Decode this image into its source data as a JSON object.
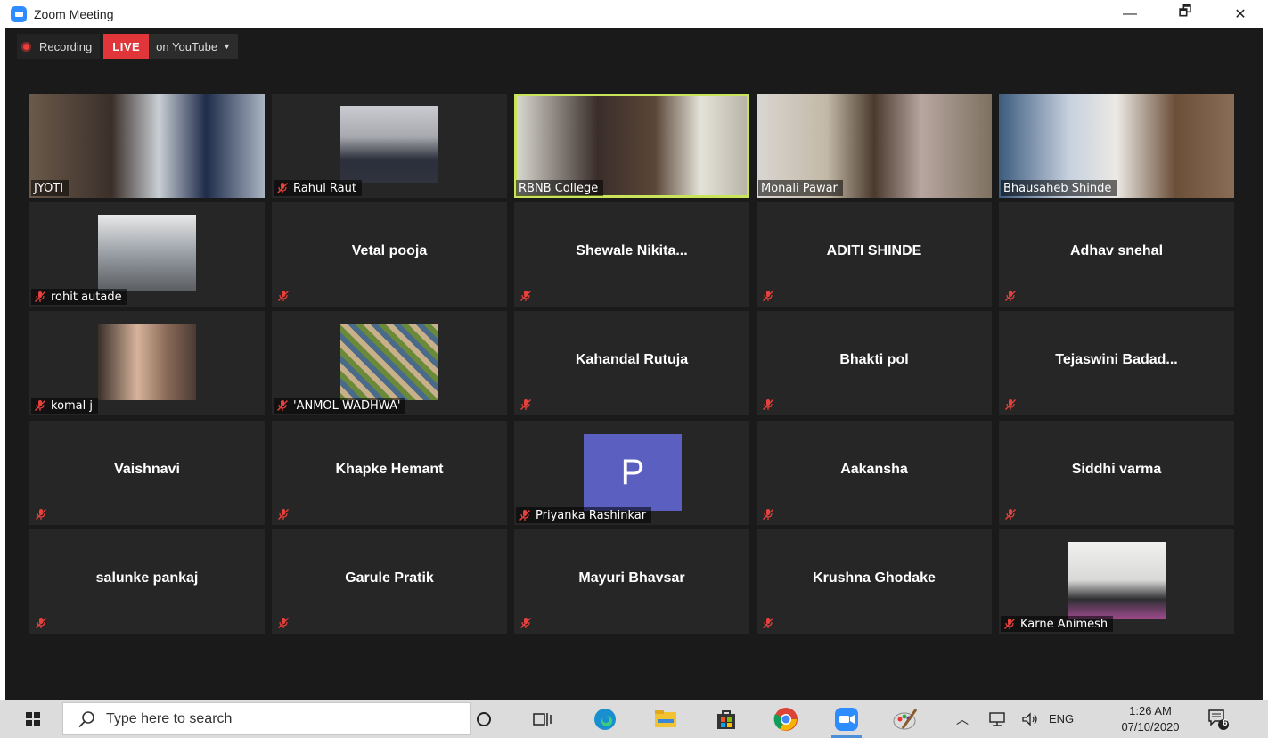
{
  "window": {
    "title": "Zoom Meeting",
    "minimize": "—",
    "restore": "🗗",
    "close": "✕"
  },
  "recording": {
    "label": "Recording",
    "live": "LIVE",
    "platform": "on YouTube",
    "caret": "▼"
  },
  "participants": [
    {
      "name": "JYOTI",
      "video": true,
      "muted": false
    },
    {
      "name": "Rahul Raut",
      "video": true,
      "muted": true
    },
    {
      "name": "RBNB College",
      "video": true,
      "muted": false,
      "active_speaker": true
    },
    {
      "name": "Monali Pawar",
      "video": true,
      "muted": false
    },
    {
      "name": "Bhausaheb Shinde",
      "video": true,
      "muted": false
    },
    {
      "name": "rohit autade",
      "video": true,
      "muted": true
    },
    {
      "name": "Vetal pooja",
      "video": false,
      "muted": true
    },
    {
      "name": "Shewale  Nikita...",
      "video": false,
      "muted": true
    },
    {
      "name": "ADITI SHINDE",
      "video": false,
      "muted": true
    },
    {
      "name": "Adhav snehal",
      "video": false,
      "muted": true
    },
    {
      "name": "komal j",
      "video": true,
      "muted": true
    },
    {
      "name": "'ANMOL WADHWA'",
      "video": true,
      "muted": true
    },
    {
      "name": "Kahandal  Rutuja",
      "video": false,
      "muted": true
    },
    {
      "name": "Bhakti pol",
      "video": false,
      "muted": true
    },
    {
      "name": "Tejaswini  Badad...",
      "video": false,
      "muted": true
    },
    {
      "name": "Vaishnavi",
      "video": false,
      "muted": true
    },
    {
      "name": "Khapke Hemant",
      "video": false,
      "muted": true
    },
    {
      "name": "Priyanka Rashinkar",
      "video": false,
      "muted": true,
      "avatar_letter": "P"
    },
    {
      "name": "Aakansha",
      "video": false,
      "muted": true
    },
    {
      "name": "Siddhi varma",
      "video": false,
      "muted": true
    },
    {
      "name": "salunke pankaj",
      "video": false,
      "muted": true
    },
    {
      "name": "Garule Pratik",
      "video": false,
      "muted": true
    },
    {
      "name": "Mayuri Bhavsar",
      "video": false,
      "muted": true
    },
    {
      "name": "Krushna Ghodake",
      "video": false,
      "muted": true
    },
    {
      "name": "Karne Animesh",
      "video": true,
      "muted": true
    }
  ],
  "taskbar": {
    "search_placeholder": "Type here to search",
    "apps": [
      "cortana-icon",
      "task-view-icon",
      "edge-icon",
      "file-explorer-icon",
      "store-icon",
      "chrome-icon",
      "zoom-icon",
      "paint-icon"
    ],
    "language": "ENG",
    "time": "1:26 AM",
    "date": "07/10/2020",
    "notifications": "6"
  },
  "colors": {
    "accent": "#2d8cff",
    "live": "#e0363a",
    "active_border": "#c9e35a",
    "tile_bg": "#262626",
    "stage_bg": "#1a1a1a",
    "avatar": "#5a5fc0"
  }
}
